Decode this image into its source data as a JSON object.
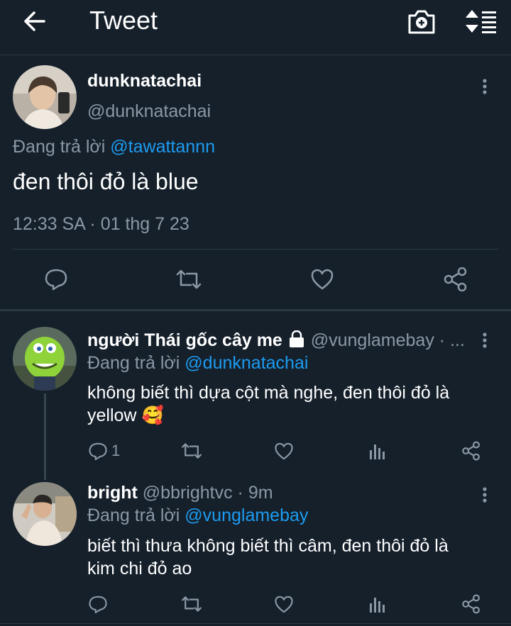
{
  "header": {
    "title": "Tweet",
    "back_icon": "arrow-left-icon",
    "camera_icon": "camera-plus-icon",
    "sort_icon": "sort-icon"
  },
  "main_tweet": {
    "name": "dunknatachai",
    "handle": "@dunknatachai",
    "reply_prefix": "Đang trả lời",
    "reply_to": "@tawattannn",
    "text": "đen thôi đỏ là blue",
    "timestamp": "12:33 SA · 01 thg 7 23"
  },
  "replies": [
    {
      "name": "người Thái gốc cây me",
      "handle": "@vunglamebay · ...",
      "reply_prefix": "Đang trả lời",
      "reply_to": "@dunknatachai",
      "text_line1": "không biết thì dựa cột mà nghe, đen thôi đỏ là",
      "text_line2": "yellow",
      "emoji": "🥰",
      "reply_count": "1"
    },
    {
      "name": "bright",
      "handle": "@bbrightvc · 9m",
      "reply_prefix": "Đang trả lời",
      "reply_to": "@vunglamebay",
      "text_line1": "biết thì thưa không biết thì câm, đen thôi đỏ là",
      "text_line2": "kim chi đỏ ao"
    }
  ],
  "colors": {
    "background": "#15202b",
    "muted": "#8b98a5",
    "link": "#1d9bf0",
    "divider": "#2c3844"
  }
}
